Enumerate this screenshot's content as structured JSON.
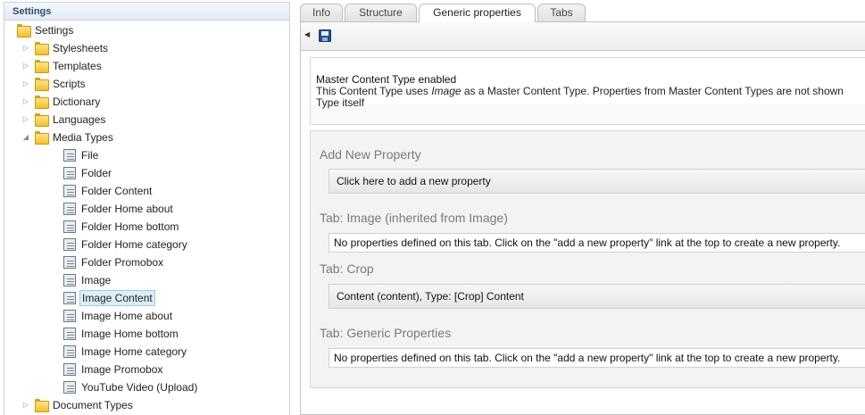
{
  "left_panel": {
    "header": "Settings",
    "tree": [
      {
        "label": "Settings",
        "icon": "folder-icon"
      },
      {
        "label": "Stylesheets",
        "icon": "folder-icon"
      },
      {
        "label": "Templates",
        "icon": "folder-icon"
      },
      {
        "label": "Scripts",
        "icon": "folder-icon"
      },
      {
        "label": "Dictionary",
        "icon": "folder-icon"
      },
      {
        "label": "Languages",
        "icon": "folder-icon"
      },
      {
        "label": "Media Types",
        "icon": "folder-icon"
      },
      {
        "label": "File",
        "icon": "media-type-icon"
      },
      {
        "label": "Folder",
        "icon": "media-type-icon"
      },
      {
        "label": "Folder Content",
        "icon": "media-type-icon"
      },
      {
        "label": "Folder Home about",
        "icon": "media-type-icon"
      },
      {
        "label": "Folder Home bottom",
        "icon": "media-type-icon"
      },
      {
        "label": "Folder Home category",
        "icon": "media-type-icon"
      },
      {
        "label": "Folder Promobox",
        "icon": "media-type-icon"
      },
      {
        "label": "Image",
        "icon": "media-type-icon"
      },
      {
        "label": "Image Content",
        "icon": "media-type-icon",
        "selected": true
      },
      {
        "label": "Image Home about",
        "icon": "media-type-icon"
      },
      {
        "label": "Image Home bottom",
        "icon": "media-type-icon"
      },
      {
        "label": "Image Home category",
        "icon": "media-type-icon"
      },
      {
        "label": "Image Promobox",
        "icon": "media-type-icon"
      },
      {
        "label": "YouTube Video (Upload)",
        "icon": "media-type-icon"
      },
      {
        "label": "Document Types",
        "icon": "folder-icon"
      }
    ]
  },
  "tabs": [
    "Info",
    "Structure",
    "Generic properties",
    "Tabs"
  ],
  "active_tab": "Generic properties",
  "master": {
    "title": "Master Content Type enabled",
    "line1_prefix": "This Content Type uses ",
    "line1_em": "Image",
    "line1_suffix": " as a Master Content Type. Properties from Master Content Types are not shown",
    "line2": "Type itself"
  },
  "properties": {
    "add_heading": "Add New Property",
    "add_link": "Click here to add a new property",
    "tab_image_heading": "Tab: Image (inherited from Image)",
    "tab_image_empty": "No properties defined on this tab. Click on the \"add a new property\" link at the top to create a new property.",
    "tab_crop_heading": "Tab: Crop",
    "tab_crop_item": "Content (content), Type: [Crop] Content",
    "tab_generic_heading": "Tab: Generic Properties",
    "tab_generic_empty": "No properties defined on this tab. Click on the \"add a new property\" link at the top to create a new property."
  },
  "colors": {
    "selected_bg": "#dbeefa",
    "heading_gray": "#7a7a7a",
    "header_text": "#2b4d70"
  }
}
